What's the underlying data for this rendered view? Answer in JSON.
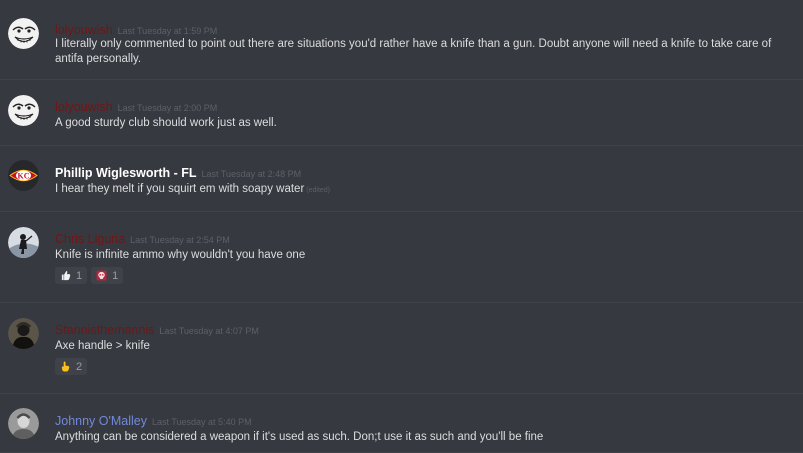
{
  "colors": {
    "background": "#36393f",
    "divider": "#40434a",
    "dark_red_name": "#6e1717",
    "blue_name": "#7289da",
    "white_name": "#ffffff"
  },
  "messages": [
    {
      "author": "lolyouwish",
      "timestamp": "Last Tuesday at 1:59 PM",
      "text": "I literally only commented to point out there are situations you'd rather have a knife than a gun. Doubt anyone will need a knife to take care of antifa personally.",
      "avatar_icon": "troll-face-avatar"
    },
    {
      "author": "lolyouwish",
      "timestamp": "Last Tuesday at 2:00 PM",
      "text": "A good sturdy club should work just as well.",
      "avatar_icon": "troll-face-avatar"
    },
    {
      "author": "Phillip Wiglesworth - FL",
      "timestamp": "Last Tuesday at 2:48 PM",
      "text": "I hear they melt if you squirt em with soapy water",
      "edited": "(edited)",
      "avatar_icon": "chiefs-logo-avatar"
    },
    {
      "author": "Chris Liguria",
      "timestamp": "Last Tuesday at 2:54 PM",
      "text": "Knife is infinite ammo why wouldn't you have one",
      "avatar_icon": "silhouette-avatar",
      "reactions": [
        {
          "emoji": "thumbs-up-emoji",
          "count": "1"
        },
        {
          "emoji": "skull-emoji",
          "count": "1"
        }
      ]
    },
    {
      "author": "Stannisthemannis",
      "timestamp": "Last Tuesday at 4:07 PM",
      "text": "Axe handle > knife",
      "avatar_icon": "dark-figure-avatar",
      "reactions": [
        {
          "emoji": "pointing-hand-emoji",
          "count": "2"
        }
      ]
    },
    {
      "author": "Johnny O'Malley",
      "timestamp": "Last Tuesday at 5:40 PM",
      "text": "Anything can be considered a weapon if it's used as such. Don;t use it as such and you'll be fine",
      "avatar_icon": "portrait-avatar"
    }
  ]
}
